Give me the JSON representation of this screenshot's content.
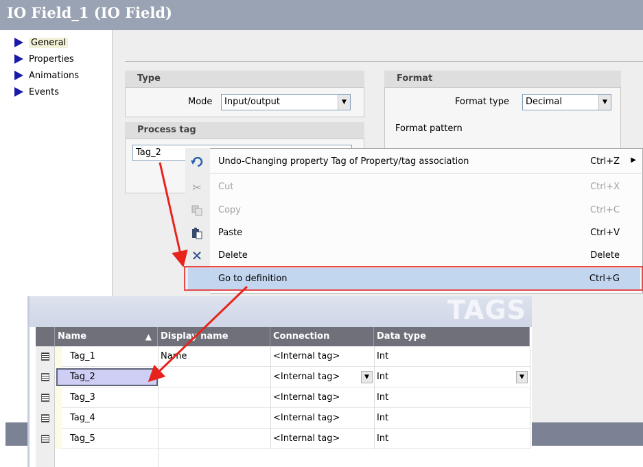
{
  "window_title": "IO Field_1 (IO Field)",
  "nav": {
    "items": [
      {
        "label": "General",
        "active": true
      },
      {
        "label": "Properties",
        "active": false
      },
      {
        "label": "Animations",
        "active": false
      },
      {
        "label": "Events",
        "active": false
      }
    ]
  },
  "type_group": {
    "title": "Type",
    "mode_label": "Mode",
    "mode_value": "Input/output"
  },
  "format_group": {
    "title": "Format",
    "format_type_label": "Format type",
    "format_type_value": "Decimal",
    "format_pattern_label": "Format pattern"
  },
  "process_tag_group": {
    "title": "Process tag",
    "tag_value": "Tag_2"
  },
  "context_menu": {
    "items": [
      {
        "icon": "undo-icon",
        "label": "Undo-Changing property Tag of Property/tag association",
        "shortcut": "Ctrl+Z",
        "submenu": true,
        "disabled": false
      },
      {
        "icon": "cut-icon",
        "label": "Cut",
        "shortcut": "Ctrl+X",
        "disabled": true
      },
      {
        "icon": "copy-icon",
        "label": "Copy",
        "shortcut": "Ctrl+C",
        "disabled": true
      },
      {
        "icon": "paste-icon",
        "label": "Paste",
        "shortcut": "Ctrl+V",
        "disabled": false
      },
      {
        "icon": "delete-icon",
        "label": "Delete",
        "shortcut": "Delete",
        "disabled": false
      },
      {
        "icon": "",
        "label": "Go to definition",
        "shortcut": "Ctrl+G",
        "disabled": false,
        "selected": true
      }
    ]
  },
  "tags_editor": {
    "title": "TAGS",
    "columns": [
      "Name",
      "Display name",
      "Connection",
      "Data type"
    ],
    "rows": [
      {
        "name": "Tag_1",
        "display_name": "Name",
        "connection": "<Internal tag>",
        "data_type": "Int"
      },
      {
        "name": "Tag_2",
        "display_name": "",
        "connection": "<Internal tag>",
        "data_type": "Int"
      },
      {
        "name": "Tag_3",
        "display_name": "",
        "connection": "<Internal tag>",
        "data_type": "Int"
      },
      {
        "name": "Tag_4",
        "display_name": "",
        "connection": "<Internal tag>",
        "data_type": "Int"
      },
      {
        "name": "Tag_5",
        "display_name": "",
        "connection": "<Internal tag>",
        "data_type": "Int"
      }
    ]
  },
  "colors": {
    "accent_arrow": "#e8231b",
    "selection": "#c3d6ef",
    "nav_arrow": "#1a1aa8"
  }
}
